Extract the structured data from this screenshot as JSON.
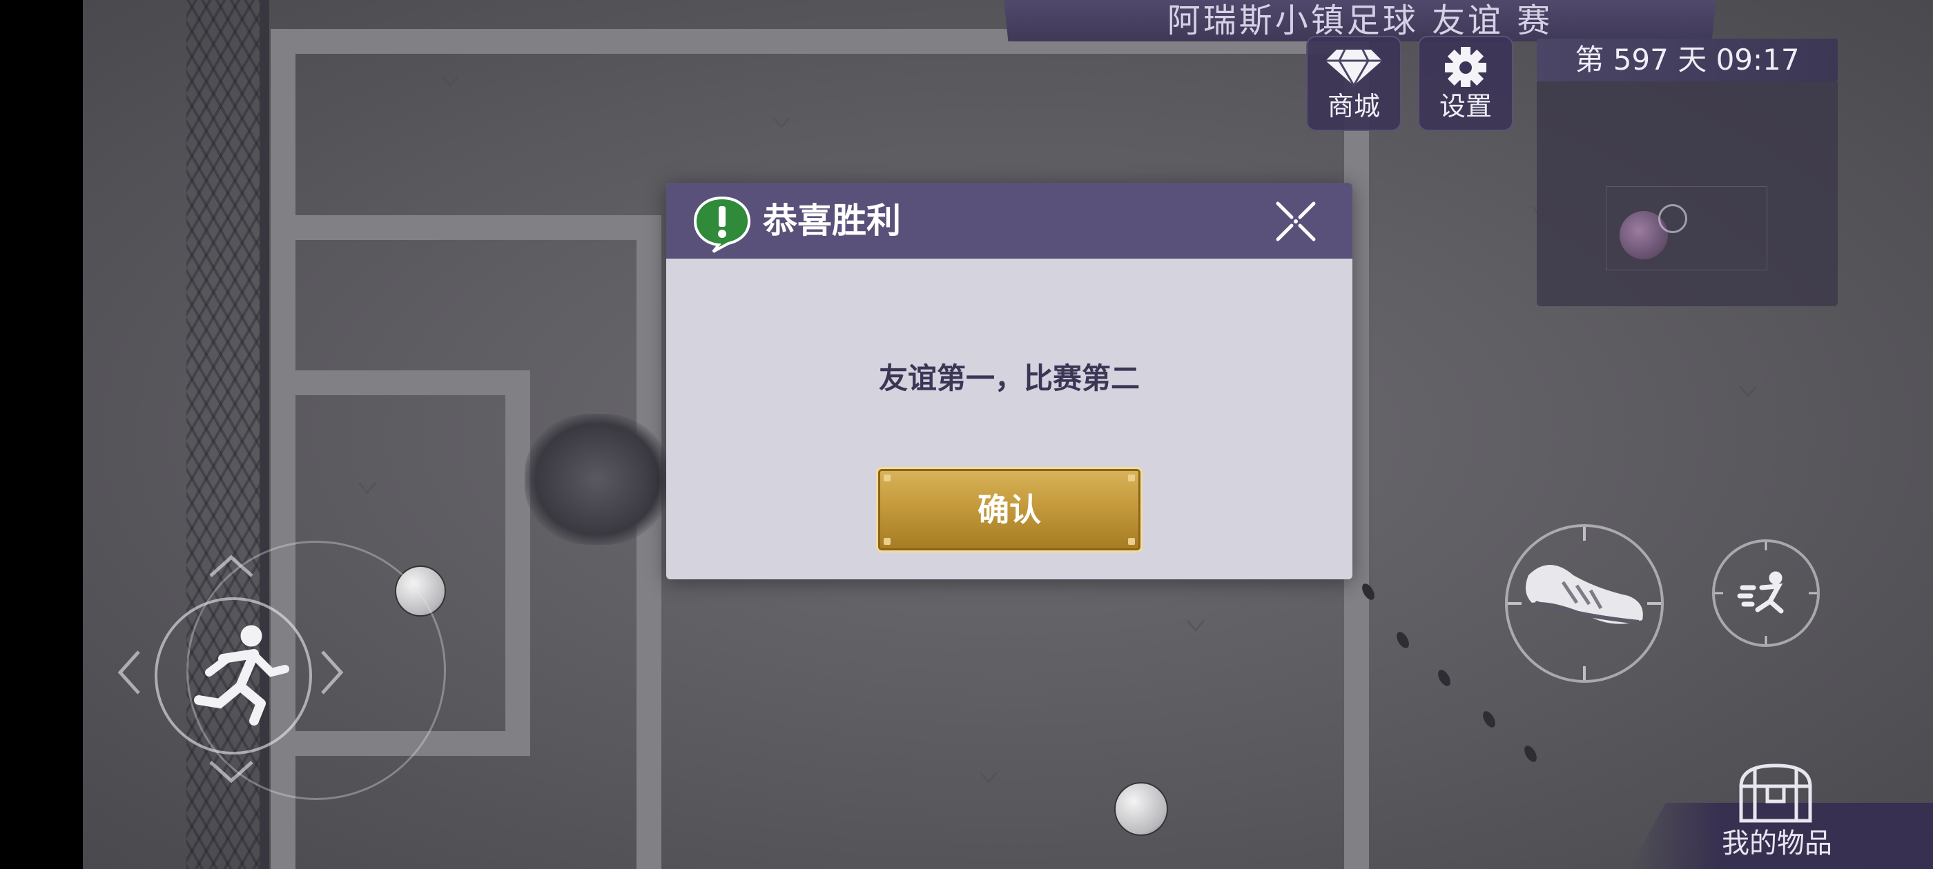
{
  "top_banner": {
    "title": "阿瑞斯小镇足球 友谊 赛"
  },
  "hud": {
    "shop_label": "商城",
    "settings_label": "设置",
    "day_time": "第 597 天 09:17"
  },
  "dialog": {
    "title": "恭喜胜利",
    "message": "友谊第一，比赛第二",
    "confirm_label": "确认"
  },
  "inventory": {
    "label": "我的物品"
  },
  "icons": {
    "shop": "diamond-icon",
    "settings": "gear-icon",
    "alert": "exclamation-bubble-icon",
    "close": "close-x-icon",
    "joystick": "running-man-icon",
    "kick": "soccer-cleat-icon",
    "sprint": "sprint-icon",
    "inventory": "treasure-chest-icon"
  },
  "colors": {
    "dialog_header": "#5a517a",
    "dialog_body": "#d5d3de",
    "confirm_gold": "#c49a3c",
    "alert_green": "#2f8a3a"
  }
}
